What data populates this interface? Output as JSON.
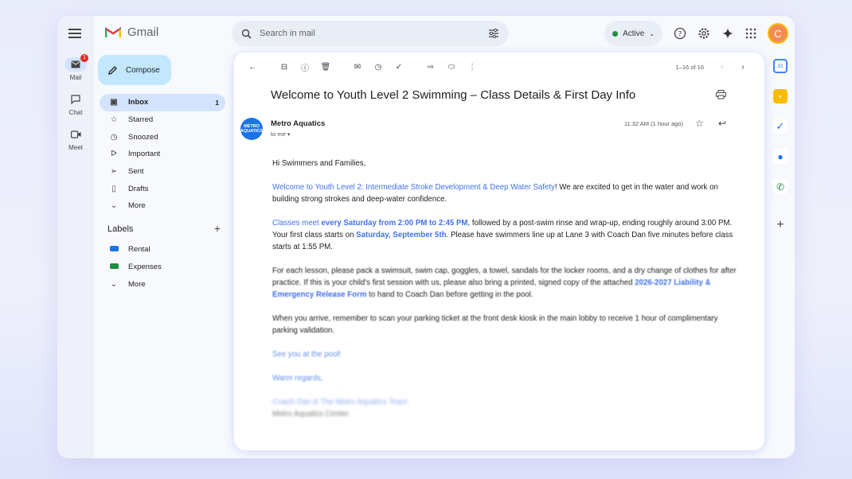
{
  "app": {
    "name": "Gmail"
  },
  "rail": [
    {
      "label": "Mail",
      "badge": "1"
    },
    {
      "label": "Chat"
    },
    {
      "label": "Meet"
    }
  ],
  "search": {
    "placeholder": "Search in mail"
  },
  "status": {
    "label": "Active"
  },
  "user": {
    "initial": "C"
  },
  "compose": {
    "label": "Compose"
  },
  "nav": [
    {
      "label": "Inbox",
      "count": "1",
      "icon": "inbox-icon"
    },
    {
      "label": "Starred",
      "icon": "star-icon"
    },
    {
      "label": "Snoozed",
      "icon": "clock-icon"
    },
    {
      "label": "Important",
      "icon": "important-icon"
    },
    {
      "label": "Sent",
      "icon": "send-icon"
    },
    {
      "label": "Drafts",
      "icon": "draft-icon"
    },
    {
      "label": "More",
      "icon": "chevron-down-icon"
    }
  ],
  "labels": {
    "title": "Labels",
    "items": [
      {
        "label": "Rental",
        "color": "#1a73e8"
      },
      {
        "label": "Expenses",
        "color": "#1e8e3e"
      },
      {
        "label": "More"
      }
    ]
  },
  "pager": "1–16 of 16",
  "email": {
    "subject": "Welcome to Youth Level 2 Swimming – Class Details & First Day Info",
    "sender": "Metro Aquatics",
    "avatar_text": "METRO AQUATICS",
    "to": "to me",
    "time": "11:32 AM (1 hour ago)",
    "greeting": "Hi Swimmers and Families,",
    "p1a": "Welcome to Youth Level 2: Intermediate Stroke Development & Deep Water Safety",
    "p1b": "! We are excited to get in the water and work on building strong strokes and deep-water confidence.",
    "p2a": "Classes meet ",
    "p2b": "every Saturday from 2:00 PM to 2:45 PM",
    "p2c": ", followed by a post-swim rinse and wrap-up, ending roughly around 3:00 PM. Your first class starts on ",
    "p2d": "Saturday, September 5th",
    "p2e": ". Please have swimmers line up at Lane 3 with Coach Dan five minutes before class starts at 1:55 PM.",
    "p3a": "For each lesson, please pack a swimsuit, swim cap, goggles, a towel, sandals for the locker rooms, and a dry change of clothes for after practice. If this is your child's first session with us, please also bring a printed, signed copy of the attached ",
    "p3b": "2026-2027 Liability & Emergency Release Form",
    "p3c": " to hand to Coach Dan before getting in the pool.",
    "p4": "When you arrive, remember to scan your parking ticket at the front desk kiosk in the main lobby to receive 1 hour of complimentary parking validation.",
    "p5": "See you at the pool!",
    "p6": "Warm regards,",
    "sig1": "Coach Dan & The Metro Aquatics Team",
    "sig2": "Metro Aquatics Center"
  },
  "colors": {
    "accent": "#c2e7ff",
    "selected": "#d3e3fd",
    "link": "#4272e6"
  }
}
